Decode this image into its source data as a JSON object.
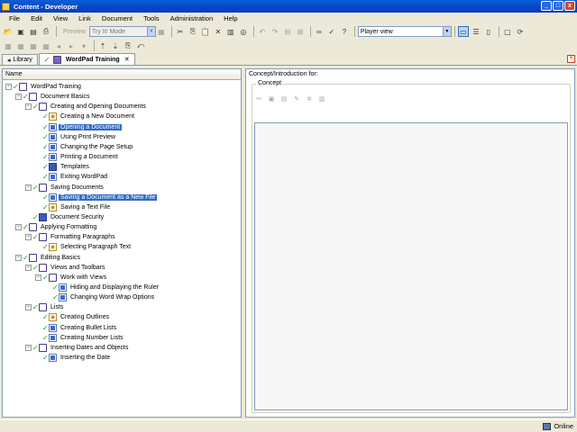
{
  "window": {
    "title": "Content - Developer",
    "buttons": [
      "_",
      "□",
      "x"
    ]
  },
  "menu": [
    "File",
    "Edit",
    "View",
    "Link",
    "Document",
    "Tools",
    "Administration",
    "Help"
  ],
  "toolbar": {
    "preview_label": "Preview",
    "mode_combo": "Try It! Mode",
    "view_combo": "Player view"
  },
  "tabs": [
    {
      "label": "Library",
      "active": false
    },
    {
      "label": "WordPad Training",
      "active": true
    }
  ],
  "tree": {
    "header": "Name",
    "nodes": [
      {
        "label": "WordPad Training",
        "level": 0,
        "type": "book"
      },
      {
        "label": "Document Basics",
        "level": 1,
        "type": "book"
      },
      {
        "label": "Creating and Opening Documents",
        "level": 2,
        "type": "book"
      },
      {
        "label": "Creating a New Document",
        "level": 3,
        "type": "concept"
      },
      {
        "label": "Opening a Document",
        "level": 3,
        "type": "topic",
        "selected": true
      },
      {
        "label": "Using Print Preview",
        "level": 3,
        "type": "topic"
      },
      {
        "label": "Changing the Page Setup",
        "level": 3,
        "type": "topic"
      },
      {
        "label": "Printing a Document",
        "level": 3,
        "type": "topic"
      },
      {
        "label": "Templates",
        "level": 3,
        "type": "ref"
      },
      {
        "label": "Exiting WordPad",
        "level": 3,
        "type": "topic"
      },
      {
        "label": "Saving Documents",
        "level": 2,
        "type": "book"
      },
      {
        "label": "Saving a Document as a New File",
        "level": 3,
        "type": "topic",
        "selected": true
      },
      {
        "label": "Saving a Text File",
        "level": 3,
        "type": "concept"
      },
      {
        "label": "Document Security",
        "level": 2,
        "type": "ref"
      },
      {
        "label": "Applying Formatting",
        "level": 1,
        "type": "book"
      },
      {
        "label": "Formatting Paragraphs",
        "level": 2,
        "type": "book"
      },
      {
        "label": "Selecting Paragraph Text",
        "level": 3,
        "type": "concept"
      },
      {
        "label": "Editing Basics",
        "level": 1,
        "type": "book"
      },
      {
        "label": "Views and Toolbars",
        "level": 2,
        "type": "book"
      },
      {
        "label": "Work with Views",
        "level": 3,
        "type": "book"
      },
      {
        "label": "Hiding and Displaying the Ruler",
        "level": 4,
        "type": "topic"
      },
      {
        "label": "Changing Word Wrap Options",
        "level": 4,
        "type": "topic"
      },
      {
        "label": "Lists",
        "level": 2,
        "type": "book"
      },
      {
        "label": "Creating Outlines",
        "level": 3,
        "type": "concept"
      },
      {
        "label": "Creating Bullet Lists",
        "level": 3,
        "type": "topic"
      },
      {
        "label": "Creating Number Lists",
        "level": 3,
        "type": "topic"
      },
      {
        "label": "Inserting Dates and Objects",
        "level": 2,
        "type": "book"
      },
      {
        "label": "Inserting the Date",
        "level": 3,
        "type": "topic"
      }
    ]
  },
  "right_panel": {
    "header": "Concept/Introduction for:",
    "group_label": "Concept"
  },
  "status": {
    "online": "Online"
  }
}
